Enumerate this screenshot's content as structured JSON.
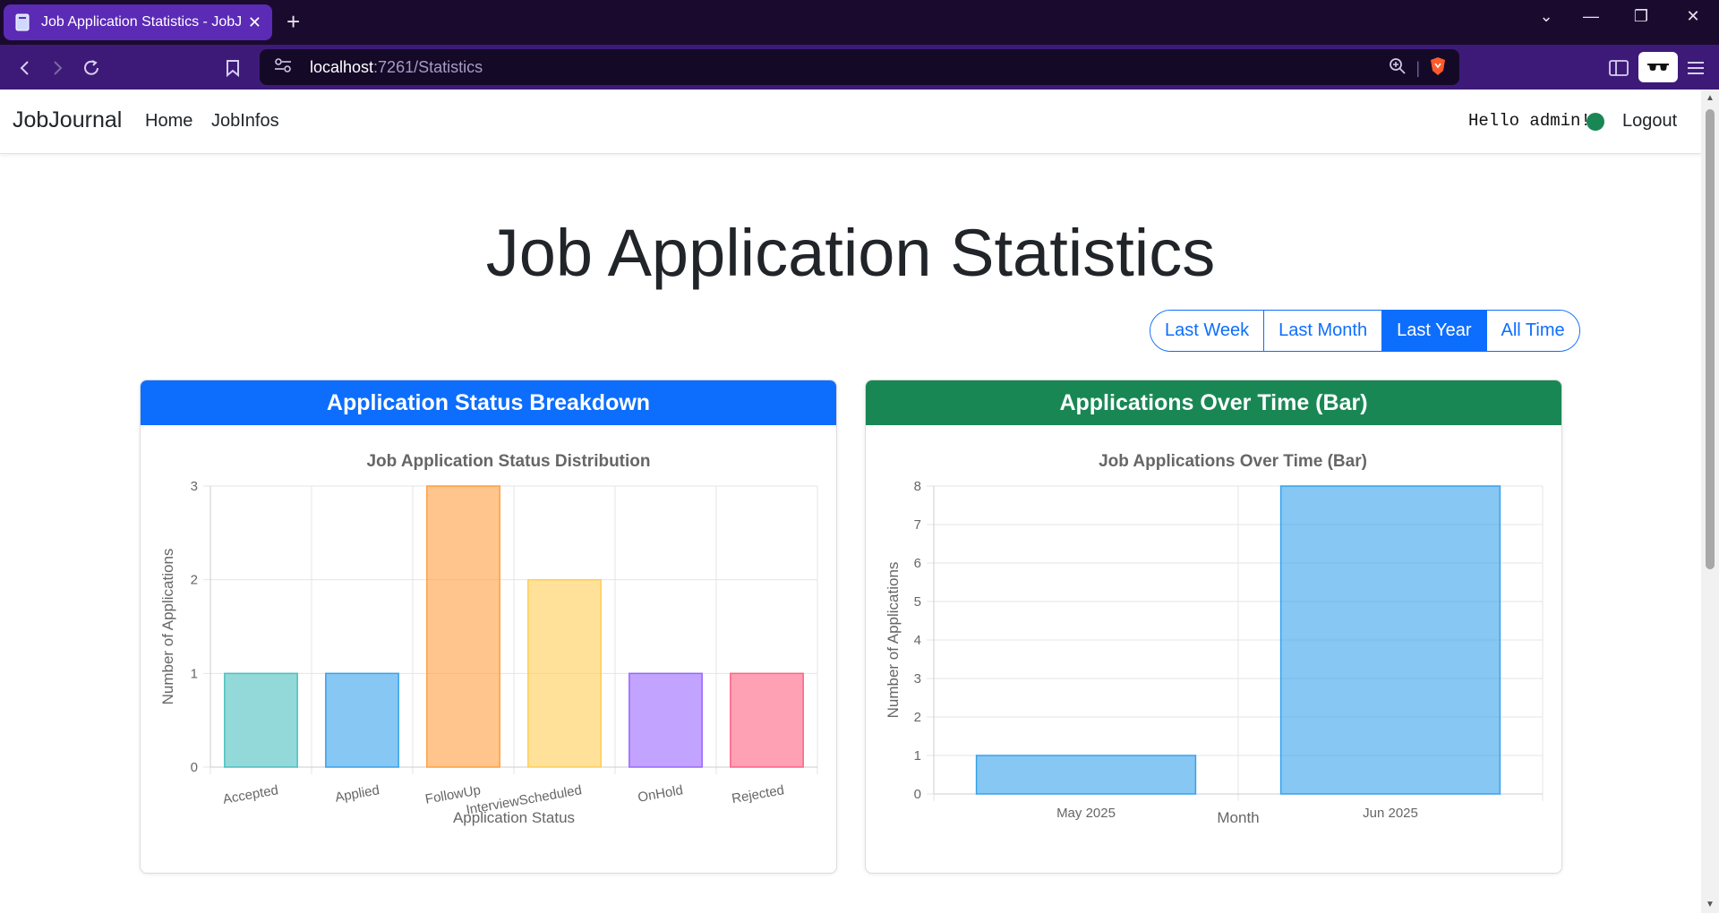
{
  "browser": {
    "tab_title": "Job Application Statistics - JobJo",
    "url_host": "localhost",
    "url_path": ":7261/Statistics"
  },
  "nav": {
    "brand": "JobJournal",
    "links": [
      "Home",
      "JobInfos"
    ],
    "greeting": "Hello admin!",
    "logout": "Logout"
  },
  "page": {
    "title": "Job Application Statistics",
    "ranges": [
      {
        "label": "Last Week",
        "active": false
      },
      {
        "label": "Last Month",
        "active": false
      },
      {
        "label": "Last Year",
        "active": true
      },
      {
        "label": "All Time",
        "active": false
      }
    ]
  },
  "colors": {
    "primary": "#0d6efd",
    "success": "#198754"
  },
  "cards": [
    {
      "header": "Application Status Breakdown",
      "header_color": "#0d6efd"
    },
    {
      "header": "Applications Over Time (Bar)",
      "header_color": "#198754"
    }
  ],
  "chart_data": [
    {
      "type": "bar",
      "title": "Job Application Status Distribution",
      "xlabel": "Application Status",
      "ylabel": "Number of Applications",
      "categories": [
        "Accepted",
        "Applied",
        "FollowUp",
        "InterviewScheduled",
        "OnHold",
        "Rejected"
      ],
      "values": [
        1,
        1,
        3,
        2,
        1,
        1
      ],
      "bar_colors": [
        "#4bc0c0",
        "#36a2eb",
        "#ff9f40",
        "#ffcd56",
        "#9966ff",
        "#ff6384"
      ],
      "ylim": [
        0,
        3
      ],
      "yticks": [
        "0",
        "1",
        "2",
        "3"
      ],
      "grid": true
    },
    {
      "type": "bar",
      "title": "Job Applications Over Time (Bar)",
      "xlabel": "Month",
      "ylabel": "Number of Applications",
      "categories": [
        "May 2025",
        "Jun 2025"
      ],
      "values": [
        1,
        8
      ],
      "bar_colors": [
        "#36a2eb",
        "#36a2eb"
      ],
      "ylim": [
        0,
        8
      ],
      "yticks": [
        "0",
        "1",
        "2",
        "3",
        "4",
        "5",
        "6",
        "7",
        "8"
      ],
      "grid": true
    }
  ]
}
